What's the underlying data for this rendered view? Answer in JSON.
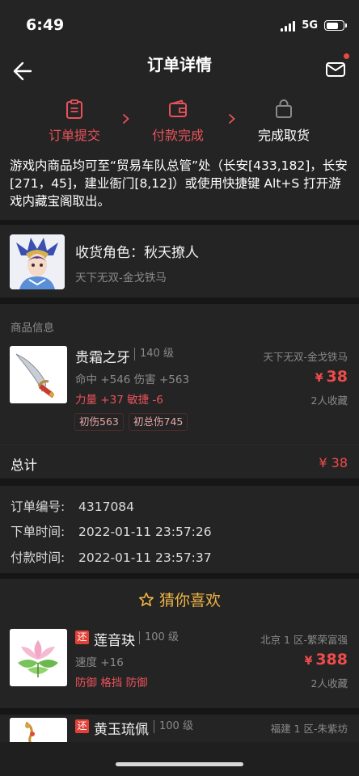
{
  "status_bar": {
    "time": "6:49",
    "network": "5G"
  },
  "nav": {
    "title": "订单详情"
  },
  "steps": [
    {
      "label": "订单提交",
      "icon": "clipboard-icon",
      "state": "done"
    },
    {
      "label": "付款完成",
      "icon": "wallet-icon",
      "state": "done"
    },
    {
      "label": "完成取货",
      "icon": "shopping-bag-icon",
      "state": "pending"
    }
  ],
  "notice": "游戏内商品均可至“贸易车队总管”处（长安[433,182]，长安[271，45]，建业衙门[8,12]）或使用快捷键 Alt+S 打开游戏内藏宝阁取出。",
  "receiver": {
    "label": "收货角色：秋天撩人",
    "server": "天下无双-金戈铁马"
  },
  "goods": {
    "section_title": "商品信息",
    "item": {
      "name": "贵霜之牙",
      "level": "140 级",
      "server": "天下无双-金戈铁马",
      "attr1": "命中 +546 伤害 +563",
      "attr2": "力量 +37 敏捷 -6",
      "price_currency": "¥",
      "price": "38",
      "favorites": "2人收藏",
      "tags": [
        "初伤563",
        "初总伤745"
      ]
    },
    "total_label": "总计",
    "total_value": "¥ 38"
  },
  "order": {
    "number_label": "订单编号:",
    "number": "4317084",
    "order_time_label": "下单时间:",
    "order_time": "2022-01-11 23:57:26",
    "pay_time_label": "付款时间:",
    "pay_time": "2022-01-11 23:57:37"
  },
  "recommend": {
    "title": "猜你喜欢",
    "items": [
      {
        "badge": "还",
        "name": "莲音玦",
        "level": "100 级",
        "server": "北京 1 区-繁荣富强",
        "attr1": "速度 +16",
        "attr2": "防御 格挡 防御",
        "price_currency": "¥",
        "price": "388",
        "favorites": "2人收藏"
      },
      {
        "badge": "还",
        "name": "黄玉琉佩",
        "level": "100 级",
        "server": "福建 1 区-朱紫坊"
      }
    ]
  },
  "colors": {
    "accent": "#e8525a",
    "price": "#f04b4b",
    "recommend_title": "#f0b445",
    "background": "#242424"
  }
}
